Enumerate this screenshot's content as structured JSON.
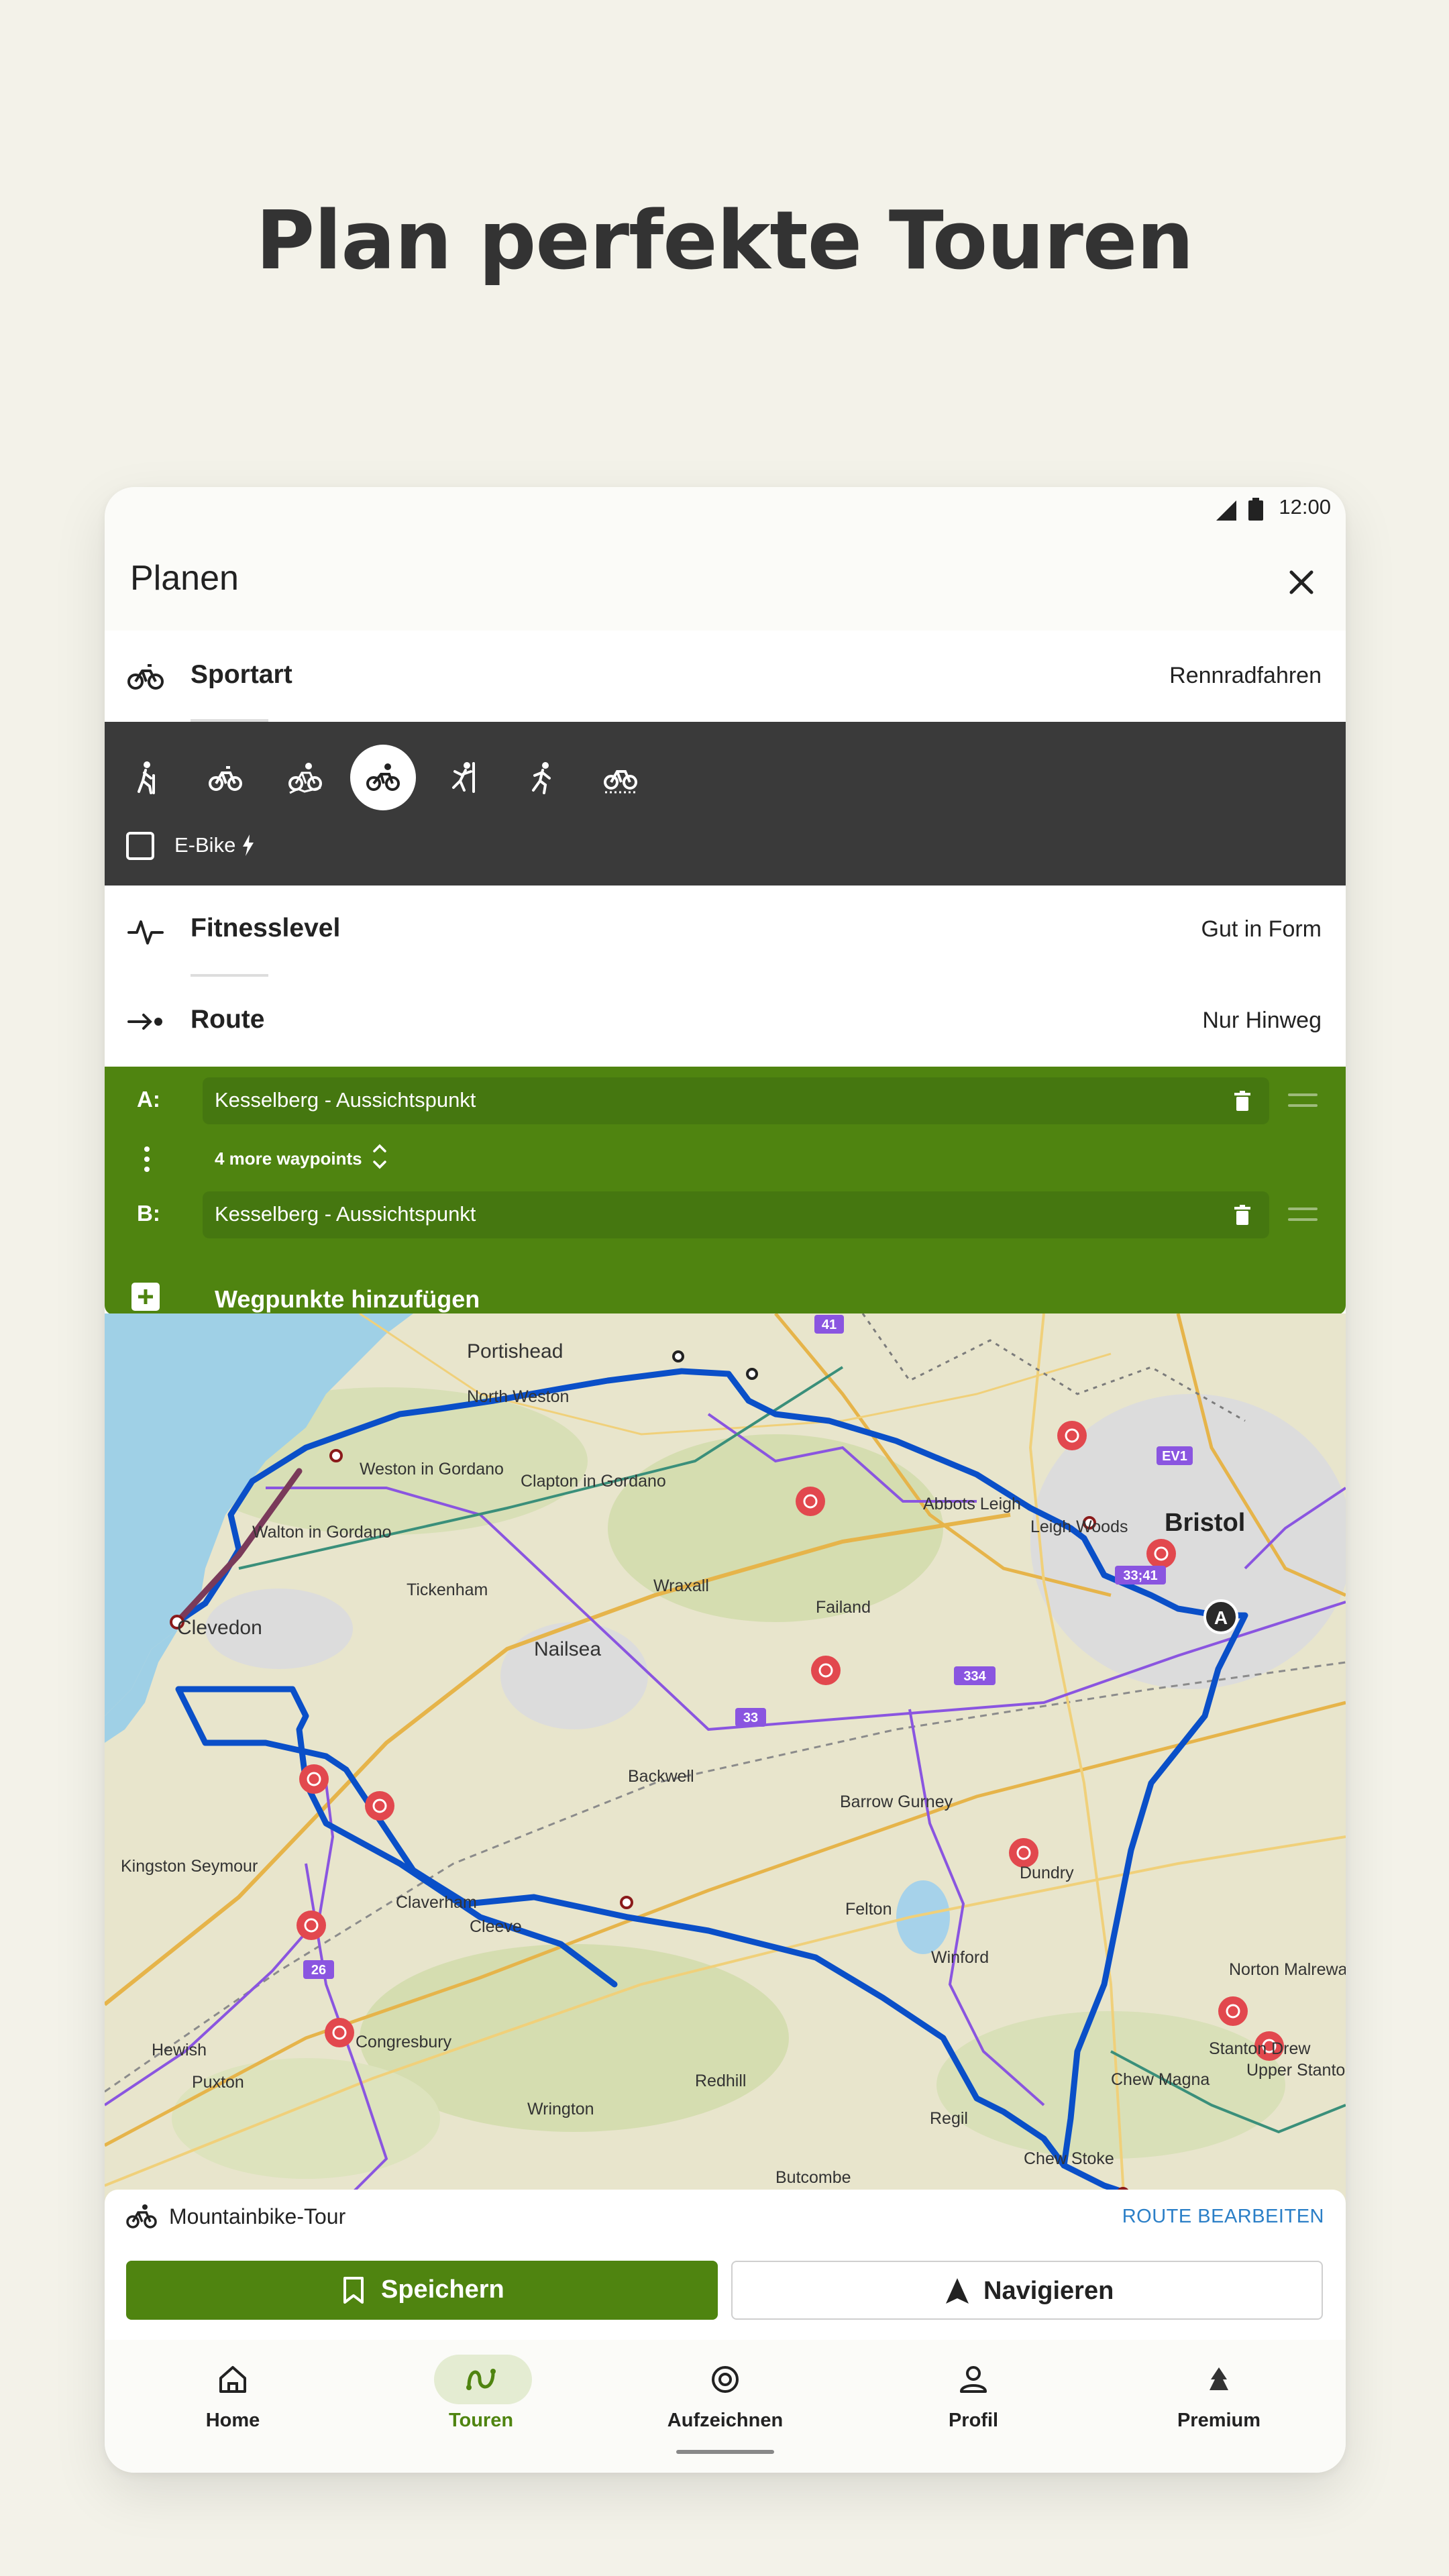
{
  "headline": "Plan perfekte Touren",
  "status": {
    "time": "12:00"
  },
  "appbar": {
    "title": "Planen"
  },
  "sport": {
    "label": "Sportart",
    "value": "Rennradfahren"
  },
  "sport_types": [
    "hiking-icon",
    "bike-icon",
    "mountainbike-icon",
    "roadbike-icon",
    "climbing-icon",
    "running-icon",
    "gravel-icon"
  ],
  "sport_selected_index": 3,
  "ebike": {
    "label": "E-Bike",
    "checked": false
  },
  "fitness": {
    "label": "Fitnesslevel",
    "value": "Gut in Form"
  },
  "route": {
    "label": "Route",
    "value": "Nur Hinweg"
  },
  "waypoints": {
    "a_tag": "A:",
    "a_value": "Kesselberg - Aussichtspunkt",
    "more_label": "4 more waypoints",
    "b_tag": "B:",
    "b_value": "Kesselberg - Aussichtspunkt",
    "add_label": "Wegpunkte hinzufügen"
  },
  "map": {
    "places": [
      "Portishead",
      "North Weston",
      "Weston in Gordano",
      "Clapton in Gordano",
      "Walton in Gordano",
      "Abbots Leigh",
      "Leigh Woods",
      "Bristol",
      "Tickenham",
      "Wraxall",
      "Failand",
      "Clevedon",
      "Nailsea",
      "Backwell",
      "Barrow Gurney",
      "Dundry",
      "Kingston Seymour",
      "Claverham",
      "Cleeve",
      "Felton",
      "Winford",
      "Norton Malreward",
      "Congresbury",
      "Hewish",
      "Puxton",
      "Chew Magna",
      "Stanton Drew",
      "Upper Stanton",
      "Redhill",
      "Wrington",
      "Regil",
      "Chew Stoke",
      "Butcombe"
    ],
    "road_labels": [
      "41",
      "EV1",
      "33;41",
      "334",
      "33",
      "26"
    ],
    "start_marker": "A"
  },
  "tourbar": {
    "type_label": "Mountainbike-Tour",
    "edit_label": "ROUTE BEARBEITEN"
  },
  "actions": {
    "save": "Speichern",
    "navigate": "Navigieren"
  },
  "nav": [
    {
      "label": "Home",
      "icon": "home-icon",
      "active": false
    },
    {
      "label": "Touren",
      "icon": "tours-icon",
      "active": true
    },
    {
      "label": "Aufzeichnen",
      "icon": "record-icon",
      "active": false
    },
    {
      "label": "Profil",
      "icon": "profile-icon",
      "active": false
    },
    {
      "label": "Premium",
      "icon": "premium-icon",
      "active": false
    }
  ],
  "colors": {
    "accent": "#4f8410",
    "dark_panel": "#3a3a3a",
    "route": "#0a4fc8",
    "link": "#2b7fc7"
  }
}
